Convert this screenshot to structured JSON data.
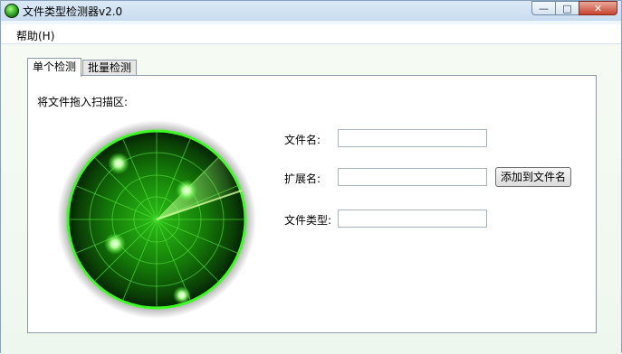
{
  "window": {
    "title": "文件类型检测器v2.0",
    "controls": {
      "minimize": "—",
      "maximize": "□",
      "close": "✕"
    }
  },
  "menu": {
    "help": "帮助(H)"
  },
  "tabs": [
    {
      "label": "单个检测",
      "active": true
    },
    {
      "label": "批量检测",
      "active": false
    }
  ],
  "single": {
    "drop_hint": "将文件拖入扫描区:",
    "fields": {
      "filename": {
        "label": "文件名:",
        "value": ""
      },
      "extension": {
        "label": "扩展名:",
        "value": ""
      },
      "filetype": {
        "label": "文件类型:",
        "value": ""
      }
    },
    "add_button": "添加到文件名"
  },
  "colors": {
    "radar_glow": "#3cff22",
    "radar_dark": "#062a04",
    "title_bar": "#c9dcef"
  },
  "icons": {
    "app": "radar-app-icon",
    "radar": "radar-scanner-icon"
  }
}
